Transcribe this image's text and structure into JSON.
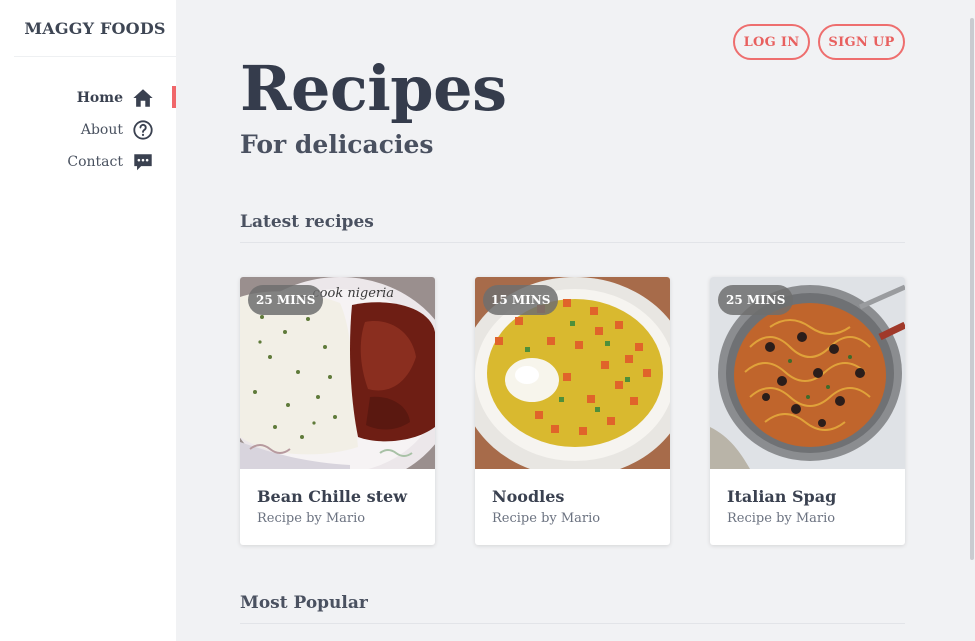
{
  "brand": {
    "name": "MAGGY FOODS"
  },
  "nav": {
    "items": [
      {
        "label": "Home",
        "icon": "home-icon",
        "active": true
      },
      {
        "label": "About",
        "icon": "help-circle-icon",
        "active": false
      },
      {
        "label": "Contact",
        "icon": "chat-icon",
        "active": false
      }
    ]
  },
  "header": {
    "login_label": "LOG IN",
    "signup_label": "SIGN UP"
  },
  "hero": {
    "title": "Recipes",
    "subtitle": "For delicacies"
  },
  "sections": {
    "latest": "Latest recipes",
    "popular": "Most Popular"
  },
  "recipes": [
    {
      "time": "25 MINS",
      "name": "Bean Chille stew",
      "author": "Recipe by Mario",
      "watermark": "...cook nigeria"
    },
    {
      "time": "15 MINS",
      "name": "Noodles",
      "author": "Recipe by Mario"
    },
    {
      "time": "25 MINS",
      "name": "Italian Spag",
      "author": "Recipe by Mario"
    }
  ],
  "colors": {
    "accent": "#ee6e6e",
    "text": "#3a4150",
    "background": "#f1f2f4",
    "badge": "#6e6e6e"
  }
}
